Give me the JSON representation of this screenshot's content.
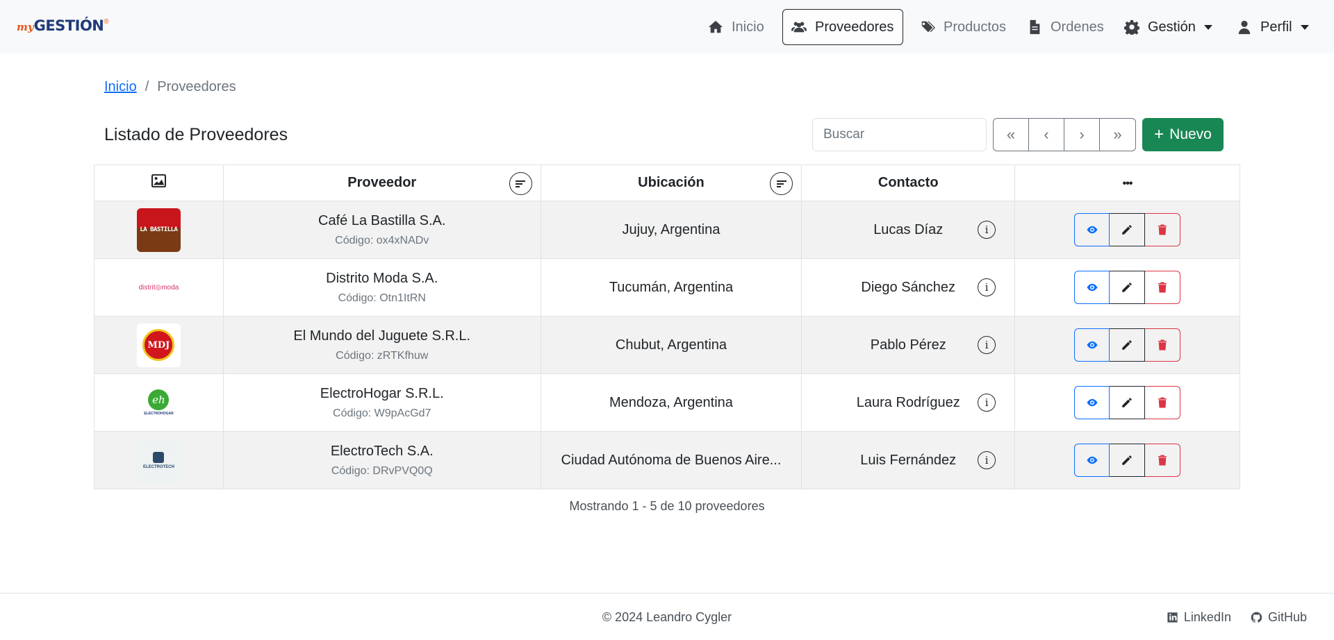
{
  "brand": {
    "my": "my",
    "name": "GESTIÓN",
    "mark": "®"
  },
  "nav": {
    "home": "Inicio",
    "suppliers": "Proveedores",
    "products": "Productos",
    "orders": "Ordenes",
    "management": "Gestión",
    "profile": "Perfil"
  },
  "breadcrumb": {
    "home": "Inicio",
    "sep": "/",
    "current": "Proveedores"
  },
  "page": {
    "title": "Listado de Proveedores"
  },
  "search": {
    "placeholder": "Buscar"
  },
  "pager": {
    "first": "«",
    "prev": "‹",
    "next": "›",
    "last": "»"
  },
  "new_button": {
    "plus": "+",
    "label": "Nuevo"
  },
  "table": {
    "headers": {
      "image": "image-icon",
      "supplier": "Proveedor",
      "location": "Ubicación",
      "contact": "Contacto",
      "actions": "•••"
    },
    "rows": [
      {
        "name": "Café La Bastilla S.A.",
        "code": "Código: ox4xNADv",
        "location": "Jujuy, Argentina",
        "contact": "Lucas Díaz",
        "logo_text": "LA BASTILLA"
      },
      {
        "name": "Distrito Moda S.A.",
        "code": "Código: Otn1ItRN",
        "location": "Tucumán, Argentina",
        "contact": "Diego Sánchez",
        "logo_text": "distrit◎moda"
      },
      {
        "name": "El Mundo del Juguete S.R.L.",
        "code": "Código: zRTKfhuw",
        "location": "Chubut, Argentina",
        "contact": "Pablo Pérez",
        "logo_text": "MDJ"
      },
      {
        "name": "ElectroHogar S.R.L.",
        "code": "Código: W9pAcGd7",
        "location": "Mendoza, Argentina",
        "contact": "Laura Rodríguez",
        "logo_text": "eh",
        "logo_sub": "ELECTROHOGAR"
      },
      {
        "name": "ElectroTech S.A.",
        "code": "Código: DRvPVQ0Q",
        "location": "Ciudad Autónoma de Buenos Aire...",
        "contact": "Luis Fernández",
        "logo_text": "ELECTROTECH"
      }
    ]
  },
  "summary": "Mostrando 1 - 5 de 10 proveedores",
  "footer": {
    "copyright": "© 2024 Leandro Cygler",
    "linkedin": "LinkedIn",
    "github": "GitHub"
  },
  "colors": {
    "primary": "#0d6efd",
    "success": "#198754",
    "danger": "#dc3545",
    "muted": "#6c757d"
  }
}
